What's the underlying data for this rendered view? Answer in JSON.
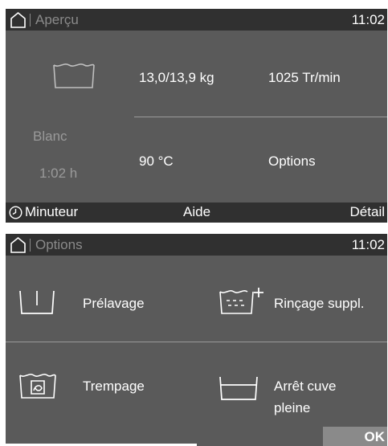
{
  "overview": {
    "title": "Aperçu",
    "time": "11:02",
    "load": "13,0/13,9 kg",
    "spin": "1025 Tr/min",
    "program": "Blanc",
    "duration": "1:02  h",
    "temperature": "90 °C",
    "options_label": "Options",
    "bottom": {
      "timer": "Minuteur",
      "help": "Aide",
      "detail": "Détail"
    },
    "icons": {
      "home": "home-icon",
      "tub": "wash-tub-icon",
      "clock": "clock-icon"
    }
  },
  "options": {
    "title": "Options",
    "time": "11:02",
    "items": [
      {
        "label": "Prélavage",
        "icon": "prewash-icon"
      },
      {
        "label": "Rinçage suppl.",
        "icon": "extra-rinse-icon"
      },
      {
        "label": "Trempage",
        "icon": "soak-icon"
      },
      {
        "label": "Arrêt cuve pleine",
        "line1": "Arrêt cuve",
        "line2": "pleine",
        "icon": "rinse-hold-icon"
      }
    ],
    "ok_label": "OK",
    "progress_fraction": 0.5
  }
}
